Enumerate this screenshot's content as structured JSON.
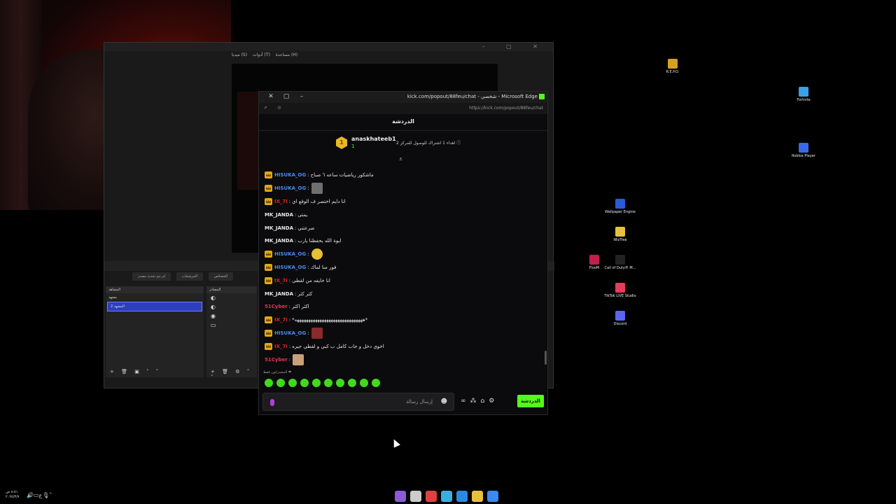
{
  "obs": {
    "menu": [
      "مساعدة (H)",
      "أدوات (T)",
      "ميديا (S)"
    ],
    "scenes_label": "المشاهد",
    "sources_label": "المصادر",
    "scenes": [
      "مشهد",
      "المشهد 2"
    ],
    "selected_scene_index": 1,
    "tabs": [
      "الخصائص",
      "المرشحات",
      "لم يتم تحديد مصدر"
    ]
  },
  "edge": {
    "title": "kick.com/popout/88feu/chat - شخصي - Microsoft Edge",
    "url": "https://kick.com/popout/88feu/chat",
    "window_controls": [
      "✕",
      "▢",
      "–"
    ]
  },
  "chat": {
    "header": "الدردشة",
    "pinned": {
      "username": "anaskhateeb1",
      "medal": "1",
      "sub_count": "1",
      "goal_text": "اهداء 1 اشتراك للوصول للمركز 2 ⓘ"
    },
    "messages": [
      {
        "user": "HISUKA_OG",
        "cls": "u-hisuka",
        "badge": true,
        "text": "ماشكور رياضيات ساعه ٦ صباح",
        "emote": ""
      },
      {
        "user": "HISUKA_OG",
        "cls": "u-hisuka",
        "badge": true,
        "text": "",
        "emote": "grey"
      },
      {
        "user": "IX_7i",
        "cls": "u-ix",
        "badge": true,
        "text": "انا دايم اختصر ف الوقع اي",
        "emote": ""
      },
      {
        "user": "MK_JANDA",
        "cls": "u-mk",
        "badge": false,
        "text": "يمتى",
        "emote": ""
      },
      {
        "user": "MK_JANDA",
        "cls": "u-mk",
        "badge": false,
        "text": "صرعتني",
        "emote": ""
      },
      {
        "user": "MK_JANDA",
        "cls": "u-mk",
        "badge": false,
        "text": "ايوة الله يحفظنا يارب",
        "emote": ""
      },
      {
        "user": "HISUKA_OG",
        "cls": "u-hisuka",
        "badge": true,
        "text": "",
        "emote": "gold"
      },
      {
        "user": "HISUKA_OG",
        "cls": "u-hisuka",
        "badge": true,
        "text": "فور منا لماك",
        "emote": ""
      },
      {
        "user": "IX_7i",
        "cls": "u-ix",
        "badge": true,
        "text": "انا خايفه من لقطي",
        "emote": ""
      },
      {
        "user": "MK_JANDA",
        "cls": "u-mk",
        "badge": false,
        "text": "كثر كثر",
        "emote": ""
      },
      {
        "user": "51Cyber",
        "cls": "u-51",
        "badge": false,
        "text": "اكثر اكثر",
        "emote": ""
      },
      {
        "user": "IX_7i",
        "cls": "u-ix",
        "badge": true,
        "text": "*ههههههههههههههههههههههههههههههه*",
        "emote": ""
      },
      {
        "user": "HISUKA_OG",
        "cls": "u-hisuka",
        "badge": true,
        "text": "",
        "emote": "red"
      },
      {
        "user": "IX_7i",
        "cls": "u-ix",
        "badge": true,
        "text": "اخوي دخل و جاب كامل ب كبي و لقطي جيره",
        "emote": ""
      },
      {
        "user": "51Cyber",
        "cls": "u-51",
        "badge": false,
        "text": "",
        "emote": "tan"
      }
    ],
    "subscribers_only": "المشتركون فقط ❤",
    "input_placeholder": "إرسال رسالة",
    "send_label": "الدردشة",
    "emote_count": 10
  },
  "desktop_icons": [
    {
      "label": "R.E.P.O.",
      "color": "#d4a020"
    },
    {
      "label": "Fortnite",
      "color": "#3aa0e8"
    },
    {
      "label": "Roblox Player",
      "color": "#3a6ae8"
    },
    {
      "label": "Wallpaper Engine",
      "color": "#2a5ad8"
    },
    {
      "label": "WizTree",
      "color": "#e8c040"
    },
    {
      "label": "FiveM",
      "color": "#c0204a"
    },
    {
      "label": "Call of Duty® M...",
      "color": "#222222"
    },
    {
      "label": "TikTok LIVE Studio",
      "color": "#e83a5a"
    },
    {
      "label": "Discord",
      "color": "#5865f2"
    }
  ],
  "taskbar": {
    "time": "٨:٥١ ص",
    "date": "٢٠٢٥/٣/٧",
    "tray_lang": "ع",
    "apps": [
      "#8a5ad8",
      "#cccccc",
      "#e04040",
      "#3ab0e0",
      "#2a8ae0",
      "#e8c040",
      "#3a8af0"
    ]
  }
}
